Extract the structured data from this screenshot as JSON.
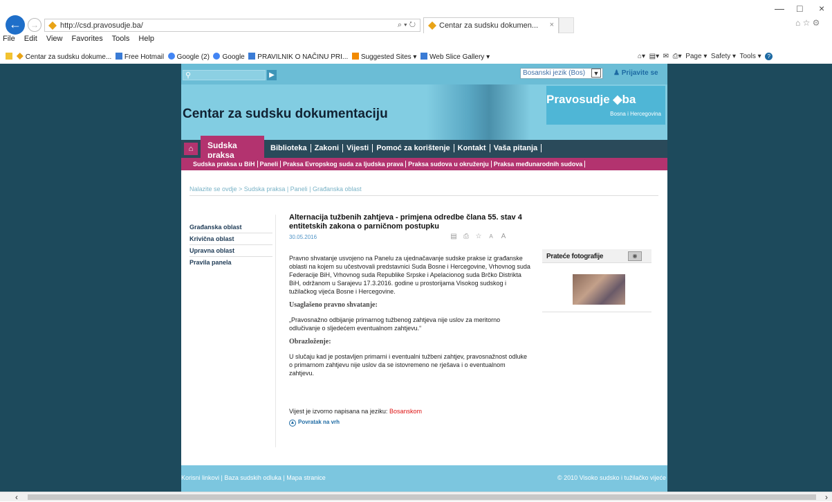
{
  "browser": {
    "url": "http://csd.pravosudje.ba/",
    "address_controls": "⌕ ▾ ↻",
    "tab_title": "Centar za sudsku dokumen...",
    "tab_close": "×",
    "menu": [
      "File",
      "Edit",
      "View",
      "Favorites",
      "Tools",
      "Help"
    ],
    "favorites": [
      "Centar za sudsku dokume...",
      "Free Hotmail",
      "Google (2)",
      "Google",
      "PRAVILNIK O NAČINU PRI...",
      "Suggested Sites ▾",
      "Web Slice Gallery ▾"
    ],
    "command_bar": [
      "Page ▾",
      "Safety ▾",
      "Tools ▾"
    ],
    "window_controls": [
      "—",
      "□",
      "×"
    ]
  },
  "site": {
    "search_placeholder": "",
    "language": "Bosanski jezik (Bos)",
    "login": "Prijavite se",
    "title": "Centar za sudsku dokumentaciju",
    "brand": "Pravosudje ◆ba",
    "brand_sub": "Bosna i Hercegovina",
    "nav_active": "Sudska praksa",
    "nav": [
      "Biblioteka",
      "Zakoni",
      "Vijesti",
      "Pomoć za korištenje",
      "Kontakt",
      "Vaša pitanja"
    ],
    "subnav": [
      "Sudska praksa u BiH",
      "Paneli",
      "Praksa Evropskog suda za ljudska prava",
      "Praksa sudova u okruženju",
      "Praksa međunarodnih sudova"
    ],
    "breadcrumb": "Nalazite se ovdje > Sudska praksa | Paneli | Građanska oblast",
    "left_nav": [
      "Građanska oblast",
      "Krivična oblast",
      "Upravna oblast",
      "Pravila panela"
    ],
    "sidebar_title": "Prateće fotografije"
  },
  "article": {
    "title": "Alternacija tužbenih zahtjeva - primjena odredbe člana 55. stav 4 entitetskih zakona o parničnom postupku",
    "date": "30.05.2016",
    "intro": "Pravno shvatanje usvojeno na Panelu za ujednačavanje sudske prakse iz građanske oblasti na kojem su učestvovali predstavnici Suda Bosne i Hercegovine, Vrhovnog suda Federacije BiH, Vrhovnog suda Republike Srpske i Apelacionog suda Brčko Distrikta BiH, održanom u Sarajevu 17.3.2016. godine u prostorijama Visokog sudskog i tužilačkog vijeća Bosne i Hercegovine.",
    "heading1": "Usaglašeno pravno shvatanje:",
    "quote": "„Pravosnažno odbijanje primarnog tužbenog zahtjeva nije uslov za meritorno odlučivanje o sljedećem eventualnom zahtjevu.“",
    "heading2": "Obrazloženje:",
    "body": "U slučaju kad je postavljen primarni i eventualni tužbeni zahtjev, pravosnažnost odluke o primarnom zahtjevu nije uslov da se istovremeno ne rješava i o eventualnom zahtjevu.",
    "lang_prefix": "Vijest je izvorno napisana na jeziku:",
    "lang_value": "Bosanskom",
    "back_to_top": "Povratak na vrh",
    "tools": [
      "▤",
      "⎙",
      "☆",
      "A",
      "A"
    ]
  },
  "footer": {
    "links": "Korisni linkovi | Baza sudskih odluka | Mapa stranice",
    "copyright": "© 2010 Visoko sudsko i tužilačko vijeće"
  }
}
